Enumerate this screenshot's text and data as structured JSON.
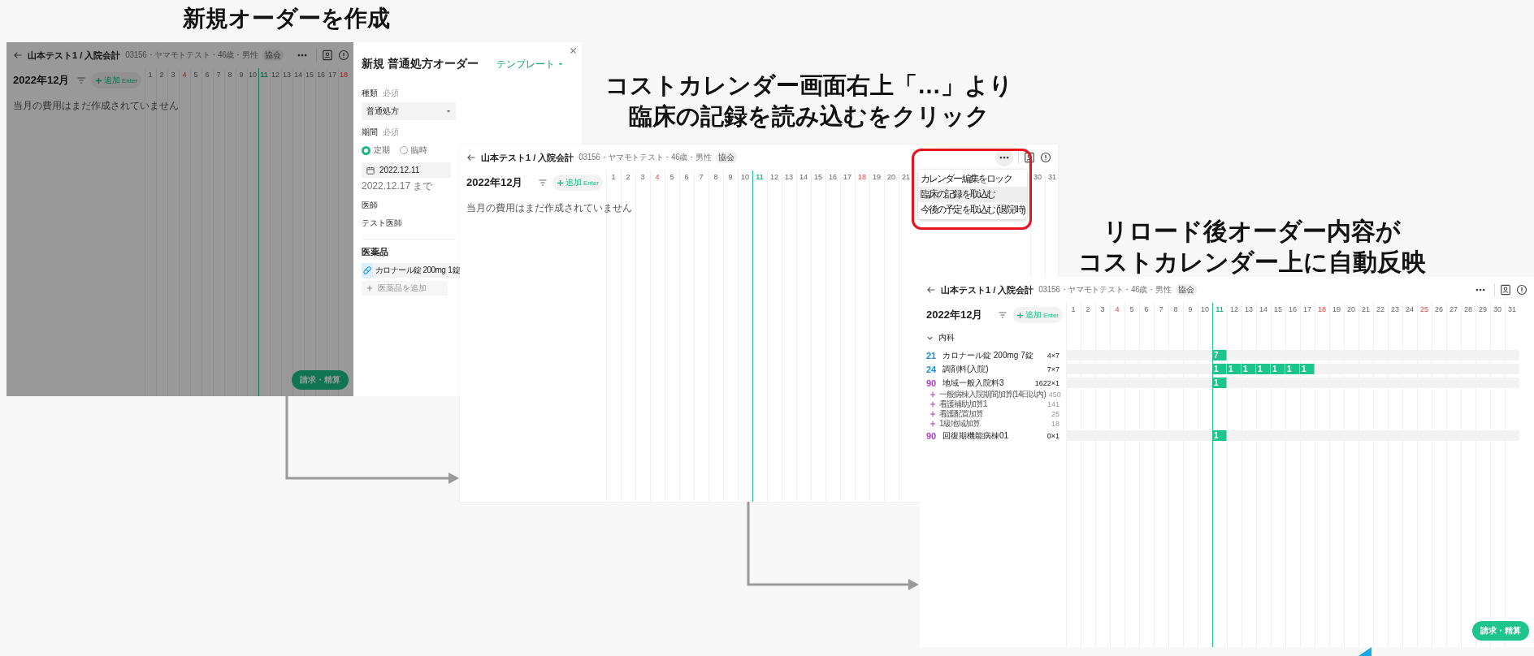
{
  "steps": [
    {
      "caption_lines": [
        "新規オーダーを作成"
      ],
      "screen": {
        "dimmed": true,
        "title": "山本テスト1 / 入院会計",
        "patient": "03156・ヤマモトテスト・46歳・男性",
        "tag": "協会",
        "month": "2022年12月",
        "add_label": "追加",
        "add_hint": "Enter",
        "days": [
          {
            "label": "1",
            "weekend": false,
            "today": false
          },
          {
            "label": "2",
            "weekend": false,
            "today": false
          },
          {
            "label": "3",
            "weekend": false,
            "today": false
          },
          {
            "label": "4",
            "weekend": true,
            "today": false
          },
          {
            "label": "5",
            "weekend": false,
            "today": false
          },
          {
            "label": "6",
            "weekend": false,
            "today": false
          },
          {
            "label": "7",
            "weekend": false,
            "today": false
          },
          {
            "label": "8",
            "weekend": false,
            "today": false
          },
          {
            "label": "9",
            "weekend": false,
            "today": false
          },
          {
            "label": "10",
            "weekend": false,
            "today": false
          },
          {
            "label": "11",
            "weekend": false,
            "today": true
          },
          {
            "label": "12",
            "weekend": false,
            "today": false
          },
          {
            "label": "13",
            "weekend": false,
            "today": false
          },
          {
            "label": "14",
            "weekend": false,
            "today": false
          },
          {
            "label": "15",
            "weekend": false,
            "today": false
          },
          {
            "label": "16",
            "weekend": false,
            "today": false
          },
          {
            "label": "17",
            "weekend": false,
            "today": false
          },
          {
            "label": "18",
            "weekend": true,
            "today": false
          }
        ],
        "empty_text": "当月の費用はまだ作成されていません",
        "bill_button": "請求・精算",
        "form": {
          "title": "新規 普通処方オーダー",
          "template_button": "テンプレート",
          "type_label": "種類",
          "type_required": "必須",
          "type_value": "普通処方",
          "period_label": "期間",
          "period_required": "必須",
          "period_options": [
            {
              "label": "定期",
              "selected": true
            },
            {
              "label": "臨時",
              "selected": false
            }
          ],
          "start_date": "2022.12.11",
          "end_hint": "2022.12.17 まで",
          "doctor_label": "医師",
          "doctor_value": "テスト医師",
          "drugs_label": "医薬品",
          "drugs": [
            {
              "name": "カロナール錠 200mg",
              "qty": "1錠"
            }
          ],
          "add_drug_placeholder": "医薬品を追加"
        }
      }
    },
    {
      "caption_lines": [
        "コストカレンダー画面右上「…」より",
        "臨床の記録を読み込むをクリック"
      ],
      "screen": {
        "dimmed": false,
        "title": "山本テスト1 / 入院会計",
        "patient": "03156・ヤマモトテスト・46歳・男性",
        "tag": "協会",
        "month": "2022年12月",
        "add_label": "追加",
        "add_hint": "Enter",
        "days": [
          {
            "label": "1",
            "weekend": false,
            "today": false
          },
          {
            "label": "2",
            "weekend": false,
            "today": false
          },
          {
            "label": "3",
            "weekend": false,
            "today": false
          },
          {
            "label": "4",
            "weekend": true,
            "today": false
          },
          {
            "label": "5",
            "weekend": false,
            "today": false
          },
          {
            "label": "6",
            "weekend": false,
            "today": false
          },
          {
            "label": "7",
            "weekend": false,
            "today": false
          },
          {
            "label": "8",
            "weekend": false,
            "today": false
          },
          {
            "label": "9",
            "weekend": false,
            "today": false
          },
          {
            "label": "10",
            "weekend": false,
            "today": false
          },
          {
            "label": "11",
            "weekend": false,
            "today": true
          },
          {
            "label": "12",
            "weekend": false,
            "today": false
          },
          {
            "label": "13",
            "weekend": false,
            "today": false
          },
          {
            "label": "14",
            "weekend": false,
            "today": false
          },
          {
            "label": "15",
            "weekend": false,
            "today": false
          },
          {
            "label": "16",
            "weekend": false,
            "today": false
          },
          {
            "label": "17",
            "weekend": false,
            "today": false
          },
          {
            "label": "18",
            "weekend": true,
            "today": false
          },
          {
            "label": "19",
            "weekend": false,
            "today": false
          },
          {
            "label": "20",
            "weekend": false,
            "today": false
          },
          {
            "label": "21",
            "weekend": false,
            "today": false
          },
          {
            "label": "30",
            "weekend": false,
            "today": false
          },
          {
            "label": "31",
            "weekend": false,
            "today": false
          }
        ],
        "empty_text": "当月の費用はまだ作成されていません",
        "menu": [
          {
            "label": "カレンダー編集をロック",
            "selected": false
          },
          {
            "label": "臨床の記録を取込む",
            "selected": true
          },
          {
            "label": "今後の予定を取込む (退院時)",
            "selected": false
          }
        ]
      }
    },
    {
      "caption_lines": [
        "リロード後オーダー内容が",
        "コストカレンダー上に自動反映"
      ],
      "screen": {
        "dimmed": false,
        "title": "山本テスト1 / 入院会計",
        "patient": "03156・ヤマモトテスト・46歳・男性",
        "tag": "協会",
        "month": "2022年12月",
        "add_label": "追加",
        "add_hint": "Enter",
        "days": [
          {
            "label": "1",
            "weekend": false,
            "today": false
          },
          {
            "label": "2",
            "weekend": false,
            "today": false
          },
          {
            "label": "3",
            "weekend": false,
            "today": false
          },
          {
            "label": "4",
            "weekend": true,
            "today": false
          },
          {
            "label": "5",
            "weekend": false,
            "today": false
          },
          {
            "label": "6",
            "weekend": false,
            "today": false
          },
          {
            "label": "7",
            "weekend": false,
            "today": false
          },
          {
            "label": "8",
            "weekend": false,
            "today": false
          },
          {
            "label": "9",
            "weekend": false,
            "today": false
          },
          {
            "label": "10",
            "weekend": false,
            "today": false
          },
          {
            "label": "11",
            "weekend": false,
            "today": true
          },
          {
            "label": "12",
            "weekend": false,
            "today": false
          },
          {
            "label": "13",
            "weekend": false,
            "today": false
          },
          {
            "label": "14",
            "weekend": false,
            "today": false
          },
          {
            "label": "15",
            "weekend": false,
            "today": false
          },
          {
            "label": "16",
            "weekend": false,
            "today": false
          },
          {
            "label": "17",
            "weekend": false,
            "today": false
          },
          {
            "label": "18",
            "weekend": true,
            "today": false
          },
          {
            "label": "19",
            "weekend": false,
            "today": false
          },
          {
            "label": "20",
            "weekend": false,
            "today": false
          },
          {
            "label": "21",
            "weekend": false,
            "today": false
          },
          {
            "label": "22",
            "weekend": false,
            "today": false
          },
          {
            "label": "23",
            "weekend": false,
            "today": false
          },
          {
            "label": "24",
            "weekend": false,
            "today": false
          },
          {
            "label": "25",
            "weekend": true,
            "today": false
          },
          {
            "label": "26",
            "weekend": false,
            "today": false
          },
          {
            "label": "27",
            "weekend": false,
            "today": false
          },
          {
            "label": "28",
            "weekend": false,
            "today": false
          },
          {
            "label": "29",
            "weekend": false,
            "today": false
          },
          {
            "label": "30",
            "weekend": false,
            "today": false
          },
          {
            "label": "31",
            "weekend": false,
            "today": false
          }
        ],
        "groups": [
          {
            "name": "内科",
            "expanded": true,
            "rows": [
              {
                "code": "21",
                "color": "#1a8fd6",
                "name": "カロナール錠 200mg 7錠",
                "qty": "4×7",
                "cells": {
                  "11": "7"
                }
              },
              {
                "code": "24",
                "color": "#1a8fd6",
                "name": "調剤料(入院)",
                "qty": "7×7",
                "cells": {
                  "11": "1",
                  "12": "1",
                  "13": "1",
                  "14": "1",
                  "15": "1",
                  "16": "1",
                  "17": "1"
                }
              },
              {
                "code": "90",
                "color": "#b03cc8",
                "name": "地域一般入院料3",
                "qty": "1622×1",
                "cells": {
                  "11": "1"
                },
                "children": [
                  {
                    "name": "一般病棟入院期間加算(14日以内)",
                    "value": "450"
                  },
                  {
                    "name": "看護補助加算1",
                    "value": "141"
                  },
                  {
                    "name": "看護配置加算",
                    "value": "25"
                  },
                  {
                    "name": "1級地域加算",
                    "value": "18"
                  }
                ]
              },
              {
                "code": "90",
                "color": "#b03cc8",
                "name": "回復期機能病棟01",
                "qty": "0×1",
                "cells": {
                  "11": "1"
                }
              }
            ]
          }
        ],
        "bill_button": "請求・精算"
      }
    }
  ]
}
